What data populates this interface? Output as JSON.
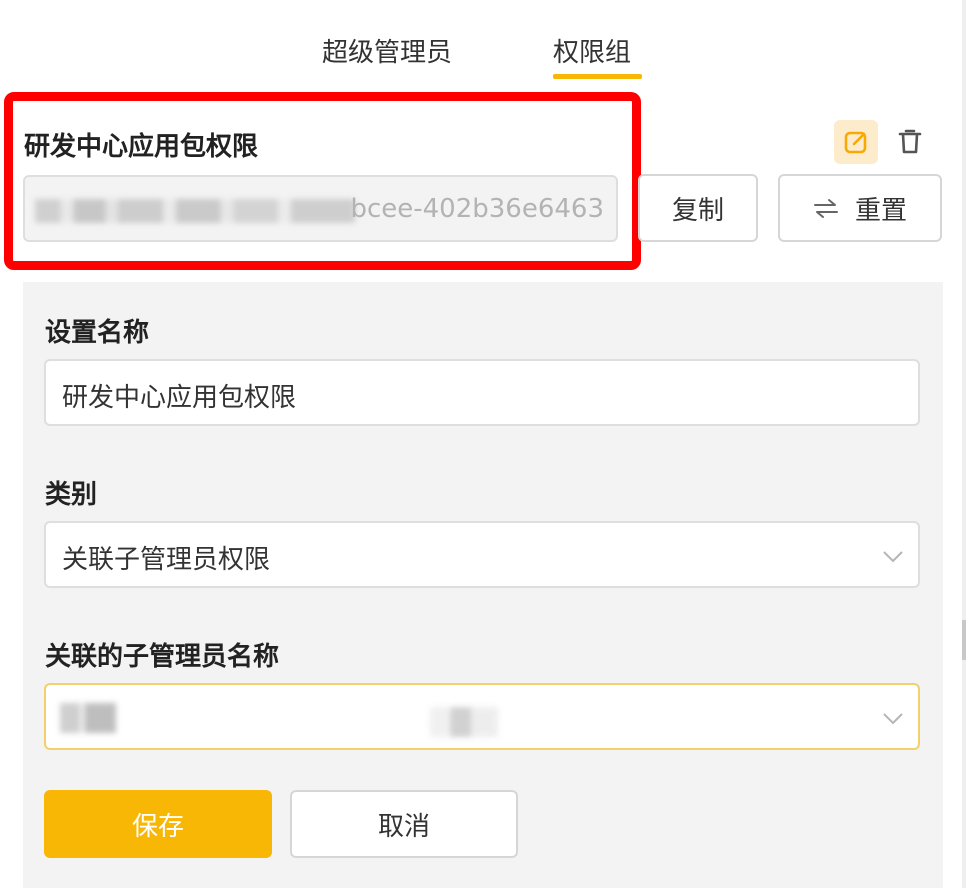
{
  "tabs": [
    {
      "label": "超级管理员",
      "active": false
    },
    {
      "label": "权限组",
      "active": true
    }
  ],
  "group": {
    "title": "研发中心应用包权限",
    "id_visible_suffix": "bcee-402b36e6463",
    "copy_label": "复制",
    "reset_icon": "swap-arrows-icon",
    "reset_label": "重置"
  },
  "icons": {
    "edit": "edit-icon",
    "delete": "trash-icon"
  },
  "form": {
    "name_label": "设置名称",
    "name_value": "研发中心应用包权限",
    "category_label": "类别",
    "category_value": "关联子管理员权限",
    "linked_label": "关联的子管理员名称",
    "linked_value": "",
    "save_label": "保存",
    "cancel_label": "取消"
  },
  "colors": {
    "accent": "#f9b705",
    "highlight_box": "#ff0000",
    "panel_bg": "#f2f3f2"
  }
}
